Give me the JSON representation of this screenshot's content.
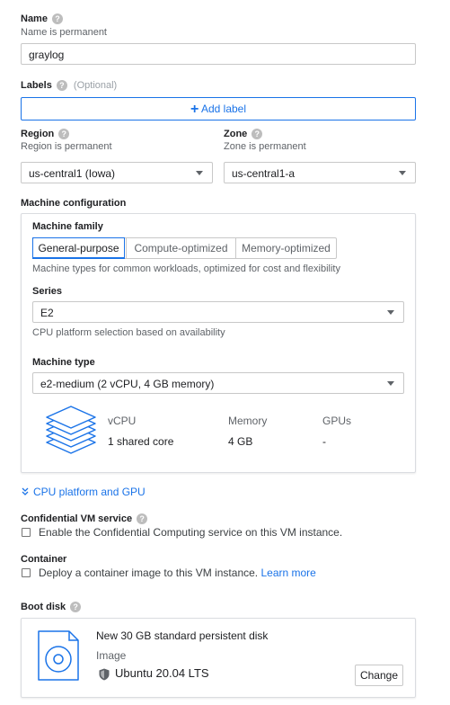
{
  "name": {
    "label": "Name",
    "hint": "Name is permanent",
    "value": "graylog"
  },
  "labels": {
    "label": "Labels",
    "optional": "(Optional)",
    "add_label": "Add label"
  },
  "region": {
    "label": "Region",
    "hint": "Region is permanent",
    "value": "us-central1 (Iowa)"
  },
  "zone": {
    "label": "Zone",
    "hint": "Zone is permanent",
    "value": "us-central1-a"
  },
  "machine_config": {
    "title": "Machine configuration",
    "family_label": "Machine family",
    "family_tabs": [
      "General-purpose",
      "Compute-optimized",
      "Memory-optimized"
    ],
    "family_desc": "Machine types for common workloads, optimized for cost and flexibility",
    "series_label": "Series",
    "series_value": "E2",
    "series_desc": "CPU platform selection based on availability",
    "type_label": "Machine type",
    "type_value": "e2-medium (2 vCPU, 4 GB memory)",
    "specs": {
      "vcpu_header": "vCPU",
      "vcpu_value": "1 shared core",
      "memory_header": "Memory",
      "memory_value": "4 GB",
      "gpus_header": "GPUs",
      "gpus_value": "-"
    }
  },
  "cpu_platform_link": "CPU platform and GPU",
  "confidential": {
    "label": "Confidential VM service",
    "checkbox_text": "Enable the Confidential Computing service on this VM instance."
  },
  "container": {
    "label": "Container",
    "checkbox_text": "Deploy a container image to this VM instance.",
    "learn_more": "Learn more"
  },
  "boot_disk": {
    "label": "Boot disk",
    "title": "New 30 GB standard persistent disk",
    "image_label": "Image",
    "image_value": "Ubuntu 20.04 LTS",
    "change_button": "Change"
  },
  "colors": {
    "accent": "#1a73e8",
    "text": "#202124",
    "muted": "#5f6368",
    "border": "#c8c8c8"
  },
  "icons": [
    "help-icon",
    "plus-icon",
    "dropdown-caret-icon",
    "layers-icon",
    "chevron-double-down-icon",
    "checkbox-icon",
    "disk-icon",
    "shield-icon"
  ]
}
